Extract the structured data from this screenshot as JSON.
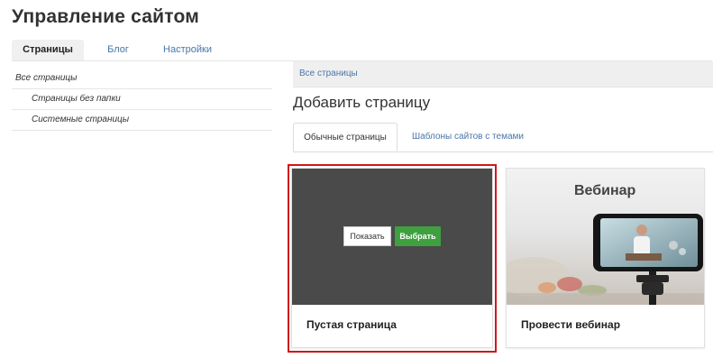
{
  "page": {
    "title": "Управление сайтом"
  },
  "top_tabs": [
    {
      "label": "Страницы",
      "active": true
    },
    {
      "label": "Блог",
      "active": false
    },
    {
      "label": "Настройки",
      "active": false
    }
  ],
  "sidebar": {
    "items": [
      {
        "label": "Все страницы"
      },
      {
        "label": "Страницы без папки"
      },
      {
        "label": "Системные страницы"
      }
    ]
  },
  "breadcrumb": {
    "label": "Все страницы"
  },
  "section": {
    "title": "Добавить страницу"
  },
  "content_tabs": [
    {
      "label": "Обычные страницы",
      "active": true
    },
    {
      "label": "Шаблоны сайтов с темами",
      "active": false
    }
  ],
  "cards": [
    {
      "title": "Пустая страница",
      "show_button": "Показать",
      "choose_button": "Выбрать",
      "selected": true
    },
    {
      "title": "Провести вебинар",
      "preview_heading": "Вебинар"
    }
  ],
  "colors": {
    "accent_link": "#4a76a8",
    "choose_button": "#3fa03f",
    "selection_outline": "#d0161b",
    "preview_dark": "#4a4a4a"
  }
}
